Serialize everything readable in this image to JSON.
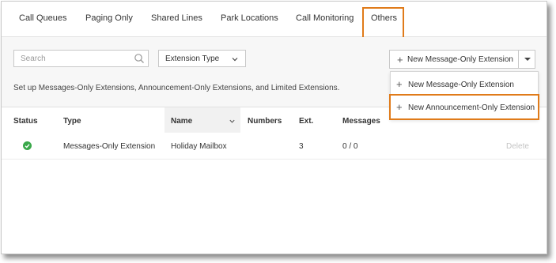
{
  "tabs": [
    {
      "label": "Call Queues"
    },
    {
      "label": "Paging Only"
    },
    {
      "label": "Shared Lines"
    },
    {
      "label": "Park Locations"
    },
    {
      "label": "Call Monitoring"
    },
    {
      "label": "Others"
    }
  ],
  "active_tab": "Others",
  "toolbar": {
    "search_placeholder": "Search",
    "filter_label": "Extension Type",
    "new_button_label": "New Message-Only Extension"
  },
  "description": "Set up Messages-Only Extensions, Announcement-Only Extensions, and Limited Extensions.",
  "dropdown": {
    "items": [
      {
        "label": "New Message-Only Extension"
      },
      {
        "label": "New Announcement-Only Extension"
      }
    ]
  },
  "table": {
    "headers": {
      "status": "Status",
      "type": "Type",
      "name": "Name",
      "numbers": "Numbers",
      "ext": "Ext.",
      "messages": "Messages"
    },
    "rows": [
      {
        "type": "Messages-Only Extension",
        "name": "Holiday Mailbox",
        "numbers": "",
        "ext": "3",
        "messages": "0 / 0",
        "action": "Delete"
      }
    ]
  },
  "colors": {
    "highlight": "#e07b1a",
    "status_ok": "#3aa84a"
  }
}
